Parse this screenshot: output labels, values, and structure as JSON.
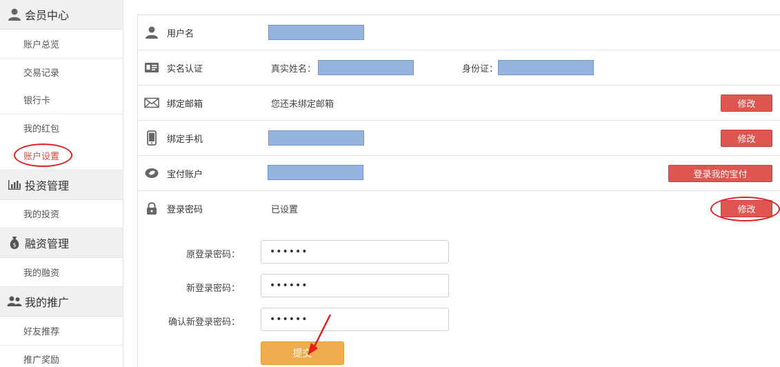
{
  "sidebar": {
    "sections": [
      {
        "title": "会员中心",
        "icon": "user-icon",
        "items": [
          "账户总览",
          "交易记录",
          "银行卡",
          "我的红包",
          "账户设置"
        ]
      },
      {
        "title": "投资管理",
        "icon": "bar-chart-icon",
        "items": [
          "我的投资"
        ]
      },
      {
        "title": "融资管理",
        "icon": "money-bag-icon",
        "items": [
          "我的融资"
        ]
      },
      {
        "title": "我的推广",
        "icon": "group-icon",
        "items": [
          "好友推荐",
          "推广奖励"
        ]
      }
    ],
    "active_item": "账户设置"
  },
  "settings": {
    "username": {
      "label": "用户名"
    },
    "realname": {
      "label": "实名认证",
      "name_label": "真实姓名：",
      "id_label": "身份证："
    },
    "email": {
      "label": "绑定邮箱",
      "value": "您还未绑定邮箱",
      "button": "修改"
    },
    "phone": {
      "label": "绑定手机",
      "button": "修改"
    },
    "baofu": {
      "label": "宝付账户",
      "button": "登录我的宝付"
    },
    "password": {
      "label": "登录密码",
      "value": "已设置",
      "button": "修改"
    }
  },
  "password_form": {
    "old_label": "原登录密码：",
    "new_label": "新登录密码：",
    "confirm_label": "确认新登录密码：",
    "old_value": "••••••",
    "new_value": "••••••",
    "confirm_value": "••••••",
    "submit": "提交"
  },
  "colors": {
    "accent_red": "#df5550",
    "submit_orange": "#f0ad4e",
    "annotation_red": "#e41d1d",
    "mask_blue": "#97b3e0"
  }
}
